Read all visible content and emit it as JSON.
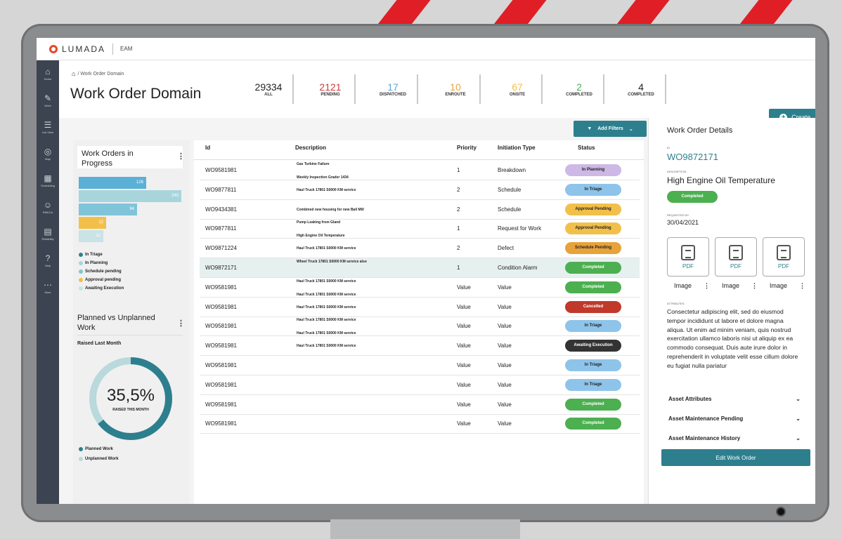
{
  "app": {
    "logo": "LUMADA",
    "product": "EAM"
  },
  "sidebar": {
    "items": [
      {
        "icon": "home-icon",
        "glyph": "⌂",
        "label": "Home"
      },
      {
        "icon": "wrench-icon",
        "glyph": "✎",
        "label": "Work"
      },
      {
        "icon": "list-icon",
        "glyph": "☰",
        "label": "List View"
      },
      {
        "icon": "map-icon",
        "glyph": "◎",
        "label": "Map"
      },
      {
        "icon": "calendar-icon",
        "glyph": "▦",
        "label": "Scheduling"
      },
      {
        "icon": "people-icon",
        "glyph": "☺",
        "label": "RMKCA"
      },
      {
        "icon": "chart-icon",
        "glyph": "▤",
        "label": "Reliability"
      },
      {
        "icon": "help-icon",
        "glyph": "?",
        "label": "Help"
      },
      {
        "icon": "more-icon",
        "glyph": "⋯",
        "label": "More"
      }
    ]
  },
  "header": {
    "breadcrumb": "/ Work Order Domain",
    "title": "Work Order Domain",
    "stats": [
      {
        "value": "29334",
        "label": "ALL",
        "color": "#222222"
      },
      {
        "value": "2121",
        "label": "PENDING",
        "color": "#d03a3a"
      },
      {
        "value": "17",
        "label": "DISPATCHED",
        "color": "#5aa6d8"
      },
      {
        "value": "10",
        "label": "ENROUTE",
        "color": "#e8a23a"
      },
      {
        "value": "67",
        "label": "ONSITE",
        "color": "#f2c04a"
      },
      {
        "value": "2",
        "label": "COMPLETED",
        "color": "#4caf50"
      },
      {
        "value": "4",
        "label": "COMPLETED",
        "color": "#222222"
      }
    ],
    "create_label": "Create"
  },
  "left": {
    "wip_title": "Work Orders in Progress",
    "wip_bars": [
      {
        "value": 126,
        "color": "#5ab0d6",
        "fraction": 0.66
      },
      {
        "value": 240,
        "color": "#a8d5dc",
        "fraction": 1.0
      },
      {
        "value": 94,
        "color": "#7fc4d8",
        "fraction": 0.57
      },
      {
        "value": 12,
        "color": "#f2c04a",
        "fraction": 0.27
      },
      {
        "value": 12,
        "color": "#c9e3e6",
        "fraction": 0.24
      }
    ],
    "wip_legend": [
      {
        "label": "In Triage",
        "color": "#2d7f8e"
      },
      {
        "label": "In Planning",
        "color": "#a8d5dc"
      },
      {
        "label": "Schedule pending",
        "color": "#7fc4d8"
      },
      {
        "label": "Approval pending",
        "color": "#f2c04a"
      },
      {
        "label": "Awaiting Execution",
        "color": "#c9e3e6"
      }
    ],
    "pvu_title": "Planned vs Unplanned Work",
    "pvu_sub": "Raised Last Month",
    "pvu_value": "35,5%",
    "pvu_value_fraction": 0.355,
    "pvu_caption": "RAISED THIS MONTH",
    "pvu_legend": [
      {
        "label": "Planned Work",
        "color": "#2d7f8e"
      },
      {
        "label": "Unplanned Work",
        "color": "#b9d9dc"
      }
    ]
  },
  "table": {
    "filter_label": "Add Filters",
    "headers": {
      "id": "Id",
      "description": "Description",
      "priority": "Priority",
      "initiation": "Initiation Type",
      "status": "Status"
    },
    "rows": [
      {
        "id": "WO9581981",
        "desc": [
          "Gas Turbine Failure",
          "Weekly Inspection Grader 1434"
        ],
        "priority": "1",
        "type": "Breakdown",
        "status": "In Planning",
        "status_color": "#cdb8e6"
      },
      {
        "id": "WO9877811",
        "desc": [
          "Haul Truck 17801 S0000 KM service"
        ],
        "priority": "2",
        "type": "Schedule",
        "status": "In Triage",
        "status_color": "#8ec4ea"
      },
      {
        "id": "WO9434381",
        "desc": [
          "Combined new housing for new Ball Mill"
        ],
        "priority": "2",
        "type": "Schedule",
        "status": "Approval Pending",
        "status_color": "#f2c04a"
      },
      {
        "id": "WO9877811",
        "desc": [
          "Pump Leaking from Gland",
          "High Engine Oil Temperature"
        ],
        "priority": "1",
        "type": "Request for Work",
        "status": "Approval Pending",
        "status_color": "#f2c04a"
      },
      {
        "id": "WO9871224",
        "desc": [
          "Haul Truck 17801 S0000 KM service"
        ],
        "priority": "2",
        "type": "Defect",
        "status": "Schedule Pending",
        "status_color": "#e8a23a"
      },
      {
        "id": "WO9872171",
        "desc": [
          "Wheel Truck 17801 S0000 KM service also",
          ""
        ],
        "priority": "1",
        "type": "Condition Alarm",
        "status": "Completed",
        "status_color": "#4caf50"
      },
      {
        "id": "WO9581981",
        "desc": [
          "Haul Truck 17801 S0000 KM service",
          "Haul Truck 17801 S0000 KM service"
        ],
        "priority": "Value",
        "type": "Value",
        "status": "Completed",
        "status_color": "#4caf50"
      },
      {
        "id": "WO9581981",
        "desc": [
          "Haul Truck 17801 S0000 KM service"
        ],
        "priority": "Value",
        "type": "Value",
        "status": "Cancelled",
        "status_color": "#c0392b"
      },
      {
        "id": "WO9581981",
        "desc": [
          "Haul Truck 17801 S0000 KM service",
          "Haul Truck 17801 S0000 KM service"
        ],
        "priority": "Value",
        "type": "Value",
        "status": "In Triage",
        "status_color": "#8ec4ea"
      },
      {
        "id": "WO9581981",
        "desc": [
          "Haul Truck 17801 S0000 KM service"
        ],
        "priority": "Value",
        "type": "Value",
        "status": "Awaiting Execution",
        "status_color": "#333333"
      },
      {
        "id": "WO9581981",
        "desc": [],
        "priority": "Value",
        "type": "Value",
        "status": "In Triage",
        "status_color": "#8ec4ea"
      },
      {
        "id": "WO9581981",
        "desc": [],
        "priority": "Value",
        "type": "Value",
        "status": "In Triage",
        "status_color": "#8ec4ea"
      },
      {
        "id": "WO9581981",
        "desc": [],
        "priority": "Value",
        "type": "Value",
        "status": "Completed",
        "status_color": "#4caf50"
      },
      {
        "id": "WO9581981",
        "desc": [],
        "priority": "Value",
        "type": "Value",
        "status": "Completed",
        "status_color": "#4caf50"
      }
    ]
  },
  "details": {
    "title": "Work Order Details",
    "id_label": "ID",
    "id": "WO9872171",
    "desc_label": "DESCRIPTION",
    "description": "High Engine Oil Temperature",
    "status": "Completed",
    "raised_label": "REQUESTED BY",
    "raised_date": "30/04/2021",
    "attachments": [
      {
        "type": "PDF",
        "label": "Image"
      },
      {
        "type": "PDF",
        "label": "Image"
      },
      {
        "type": "PDF",
        "label": "Image"
      }
    ],
    "attr_label": "ATTRIBUTES",
    "body": "Consectetur adipiscing elit, sed do eiusmod tempor incididunt ut labore et dolore magna aliqua. Ut enim ad minim veniam, quis nostrud exercitation ullamco laboris nisi ut aliquip ex ea commodo consequat. Duis aute irure dolor in reprehenderit in voluptate velit esse cillum dolore eu fugiat nulla pariatur",
    "accordions": [
      "Asset Attributes",
      "Asset Maintenance Pending",
      "Asset Maintenance History"
    ],
    "edit_label": "Edit Work Order"
  }
}
